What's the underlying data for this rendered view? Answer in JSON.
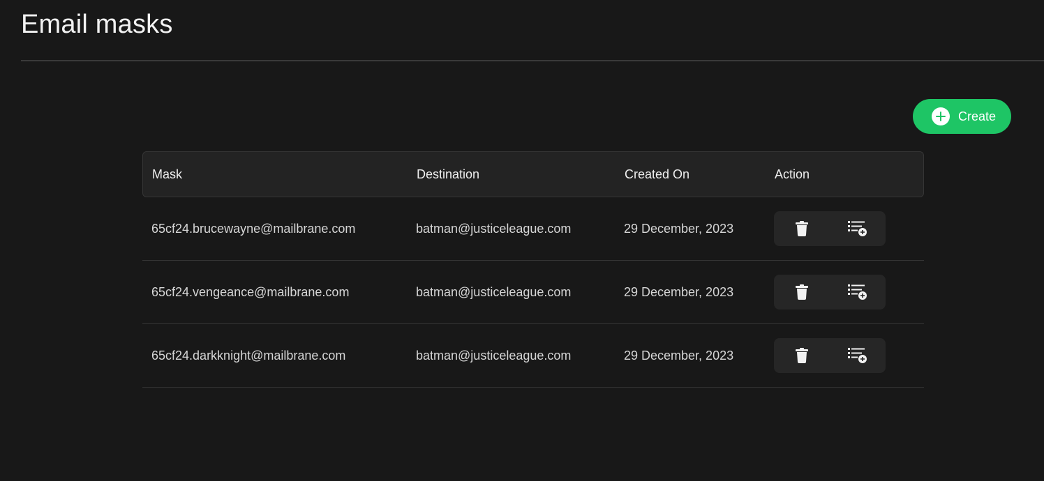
{
  "page": {
    "title": "Email masks"
  },
  "toolbar": {
    "create_label": "Create",
    "create_icon": "plus-circle-icon",
    "accent_color": "#1ec565"
  },
  "table": {
    "columns": [
      "Mask",
      "Destination",
      "Created On",
      "Action"
    ],
    "rows": [
      {
        "mask": "65cf24.brucewayne@mailbrane.com",
        "destination": "batman@justiceleague.com",
        "created_on": "29 December, 2023",
        "actions": [
          "trash-icon",
          "list-add-icon"
        ]
      },
      {
        "mask": "65cf24.vengeance@mailbrane.com",
        "destination": "batman@justiceleague.com",
        "created_on": "29 December, 2023",
        "actions": [
          "trash-icon",
          "list-add-icon"
        ]
      },
      {
        "mask": "65cf24.darkknight@mailbrane.com",
        "destination": "batman@justiceleague.com",
        "created_on": "29 December, 2023",
        "actions": [
          "trash-icon",
          "list-add-icon"
        ]
      }
    ]
  }
}
